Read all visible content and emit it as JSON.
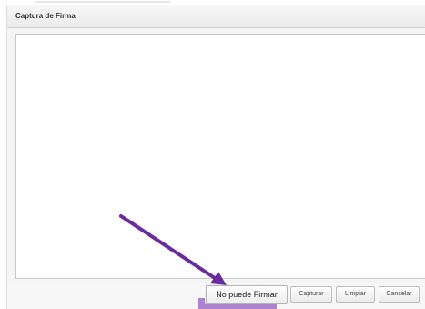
{
  "dialog": {
    "title": "Captura de Firma"
  },
  "buttons": {
    "no_puede_firmar": "No puede Firmar",
    "capturar": "Capturar",
    "limpiar": "Limpiar",
    "cancelar": "Cancelar"
  },
  "annotation": {
    "arrow_color": "#6b2a9e",
    "highlight_color": "#a06fc8"
  },
  "icons": [
    "annotation-arrow-icon"
  ]
}
